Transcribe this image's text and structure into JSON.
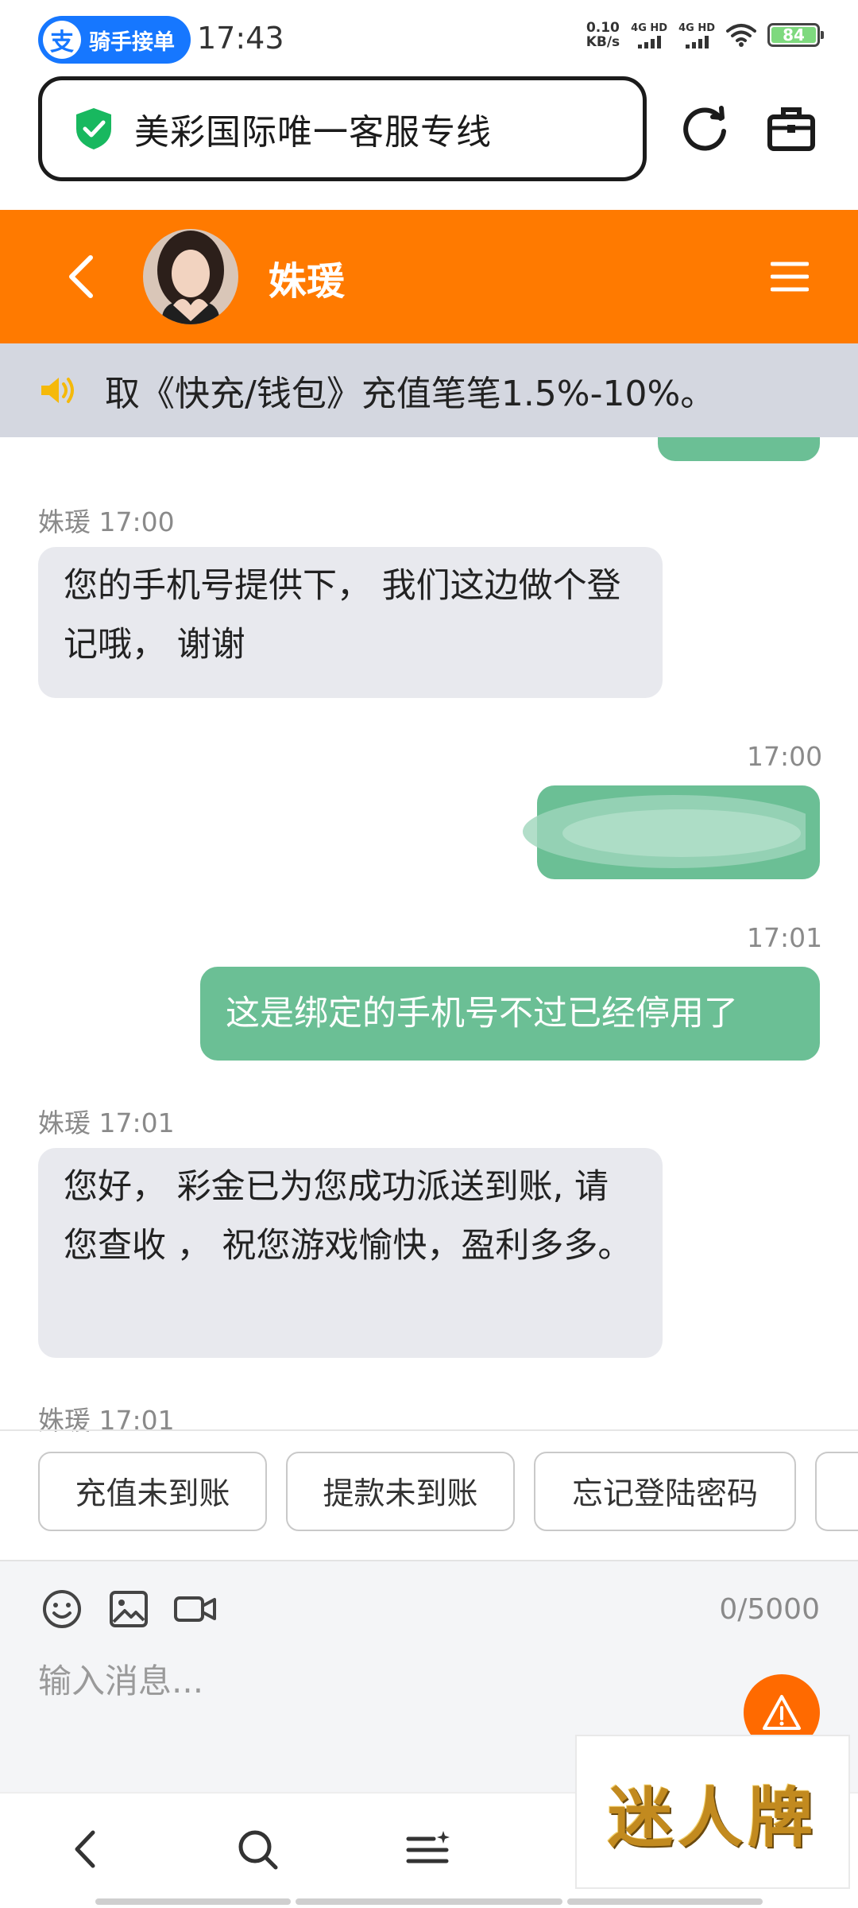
{
  "status_bar": {
    "app_pill_logo": "支",
    "app_pill_label": "骑手接单",
    "time": "17:43",
    "net_speed_value": "0.10",
    "net_speed_unit": "KB/s",
    "sim1": "4G HD",
    "sim2": "4G HD",
    "battery": "84"
  },
  "browser": {
    "title": "美彩国际唯一客服专线",
    "shield_color": "#18b85f"
  },
  "chat_header": {
    "agent_name": "姝瑗",
    "header_color": "#ff7a00"
  },
  "notice": {
    "text": "取《快充/钱包》充值笔笔1.5%-10%。"
  },
  "messages": [
    {
      "sender": "姝瑗",
      "time": "17:00",
      "text": "您的手机号提供下， 我们这边做个登记哦， 谢谢"
    },
    {
      "time": "17:00",
      "text": ""
    },
    {
      "time": "17:01",
      "text": "这是绑定的手机号不过已经停用了"
    },
    {
      "sender": "姝瑗",
      "time": "17:01",
      "text": "您好， 彩金已为您成功派送到账, 请您查收 ， 祝您游戏愉快，盈利多多。"
    },
    {
      "sender": "姝瑗",
      "time": "17:01"
    }
  ],
  "quick_replies": [
    "充值未到账",
    "提款未到账",
    "忘记登陆密码"
  ],
  "composer": {
    "placeholder": "输入消息...",
    "counter": "0/5000"
  },
  "watermark": {
    "text": "迷人牌"
  },
  "colors": {
    "outgoing_bubble": "#6bbf95",
    "incoming_bubble": "#e8e9ee",
    "accent": "#ff7a00"
  }
}
